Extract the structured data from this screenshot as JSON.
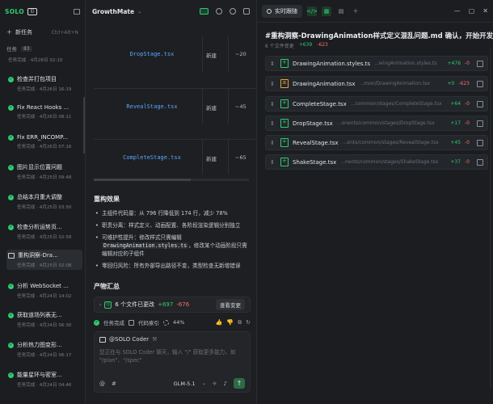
{
  "sidebar": {
    "logo": "SOLO",
    "logo_badge": "◫",
    "new_task": "新任务",
    "new_task_shortcut": "Ctrl+Alt+N",
    "tasks_label": "任务",
    "tasks_count": "83",
    "first_meta": "任务完成 · 4月28日 02:10",
    "tasks": [
      {
        "title": "检查并打包项目",
        "meta": "任务完成 · 4月26日 16:19"
      },
      {
        "title": "Fix React Hooks ...",
        "meta": "任务完成 · 4月26日 08:11"
      },
      {
        "title": "Fix ERR_INCOMP...",
        "meta": "任务完成 · 4月26日 07:16"
      },
      {
        "title": "图片显示位置问题",
        "meta": "任务完成 · 4月25日 09:48"
      },
      {
        "title": "总结本月重大调整",
        "meta": "任务完成 · 4月25日 03:50"
      },
      {
        "title": "检查分析运势页...",
        "meta": "任务完成 · 4月25日 02:58"
      },
      {
        "title": "重构洞察-Dra...",
        "meta": "任务完成 · 4月25日 02:08"
      },
      {
        "title": "分析 WebSocket ...",
        "meta": "任务完成 · 4月24日 14:02"
      },
      {
        "title": "获取道场列表无...",
        "meta": "任务完成 · 4月24日 06:30"
      },
      {
        "title": "分析热力图变形...",
        "meta": "任务完成 · 4月24日 06:17"
      },
      {
        "title": "能量星环与密室...",
        "meta": "任务完成 · 4月24日 04:46"
      }
    ]
  },
  "mid": {
    "project": "GrowthMate",
    "table": [
      {
        "file": "DropStage.tsx",
        "action": "新建",
        "lines": "~20"
      },
      {
        "file": "RevealStage.tsx",
        "action": "新建",
        "lines": "~45"
      },
      {
        "file": "CompleteStage.tsx",
        "action": "新建",
        "lines": "~65"
      }
    ],
    "effects_title": "重构效果",
    "bullets": [
      "主组件代码量：从 796 行降低到 174 行，减少 78%",
      "职责分离：样式定义、动画配置、各阶段渲染逻辑分别独立",
      "可维护性提升：修改样式只需编辑",
      "DrawingAnimation.styles.ts",
      "，修改某个动画阶段只需编辑对应的子组件",
      "零回归风险：所有外部导出路径不变，类型检查无新增错误"
    ],
    "summary_title": "产物汇总",
    "changes_text": "6 个文件已更改",
    "changes_plus": "+697",
    "changes_minus": "-676",
    "view_changes": "查看变更",
    "status_done": "任务完成",
    "status_index": "代码索引",
    "status_pct": "44%",
    "input_agent": "@SOLO Coder",
    "input_placeholder": "您正在与 SOLO Coder 聊天，输入 \"/\" 获取更多能力，如 \"/plan\"、\"/spec\"",
    "model": "GLM-5.1"
  },
  "right": {
    "tab_label": "实时跟随",
    "title": "#重构洞察-DrawingAnimation样式定义混乱问题.md 确认，开始开发！",
    "sub_files": "6 个文件变更",
    "sub_plus": "+639",
    "sub_minus": "-623",
    "files": [
      {
        "name": "DrawingAnimation.styles.ts",
        "path": "...wingAnimation.styles.ts",
        "plus": "+476",
        "minus": "-0",
        "type": "new"
      },
      {
        "name": "DrawingAnimation.tsx",
        "path": "...mon/DrawingAnimation.tsx",
        "plus": "+0",
        "minus": "-623",
        "type": "mod"
      },
      {
        "name": "CompleteStage.tsx",
        "path": "...common/stages/CompleteStage.tsx",
        "plus": "+64",
        "minus": "-0",
        "type": "new"
      },
      {
        "name": "DropStage.tsx",
        "path": "...onents/common/stages/DropStage.tsx",
        "plus": "+17",
        "minus": "-0",
        "type": "new"
      },
      {
        "name": "RevealStage.tsx",
        "path": "...ents/common/stages/RevealStage.tsx",
        "plus": "+45",
        "minus": "-0",
        "type": "new"
      },
      {
        "name": "ShakeStage.tsx",
        "path": "...nents/common/stages/ShakeStage.tsx",
        "plus": "+37",
        "minus": "-0",
        "type": "new"
      }
    ]
  }
}
